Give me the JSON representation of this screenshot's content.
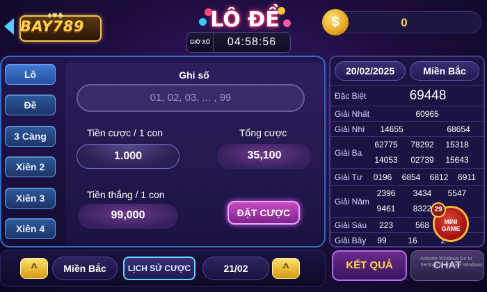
{
  "header": {
    "logo": "BAY789",
    "title": "LÔ ĐỀ",
    "timer_label": "GIỜ XỔ",
    "timer_value": "04:58:56",
    "balance": "0"
  },
  "tabs": [
    "Lô",
    "Đề",
    "3 Càng",
    "Xiên 2",
    "Xiên 3",
    "Xiên 4"
  ],
  "form": {
    "numbers_label": "Ghi số",
    "numbers_placeholder": "01, 02, 03, ... , 99",
    "bet_per_label": "Tiền cược / 1 con",
    "bet_per_value": "1.000",
    "total_label": "Tổng cược",
    "total_value": "35,100",
    "win_per_label": "Tiền thắng / 1 con",
    "win_per_value": "99,000",
    "place_bet_label": "ĐẶT CƯỢC"
  },
  "bottom": {
    "region": "Miền Bắc",
    "history_label": "LỊCH SỬ CƯỢC",
    "date": "21/02",
    "up_symbol": "^"
  },
  "results": {
    "date": "20/02/2025",
    "region": "Miền Bắc",
    "rows": [
      {
        "label": "Đặc Biệt",
        "values": [
          "69448"
        ]
      },
      {
        "label": "Giải Nhất",
        "values": [
          "60965"
        ]
      },
      {
        "label": "Giải Nhì",
        "values": [
          "14655",
          "68654"
        ]
      },
      {
        "label": "Giải Ba",
        "values": [
          "62775",
          "78292",
          "15318",
          "14053",
          "02739",
          "15643"
        ]
      },
      {
        "label": "Giải Tư",
        "values": [
          "0196",
          "6854",
          "6812",
          "6911"
        ]
      },
      {
        "label": "Giải Năm",
        "values": [
          "2396",
          "3434",
          "5547",
          "9461",
          "8322",
          ""
        ]
      },
      {
        "label": "Giải Sáu",
        "values": [
          "223",
          "568",
          ""
        ]
      },
      {
        "label": "Giải Bảy",
        "values": [
          "99",
          "16",
          "2",
          ""
        ]
      }
    ]
  },
  "mini_game": {
    "count": "29",
    "label_1": "MINI",
    "label_2": "GAME"
  },
  "actions": {
    "result_label": "KẾT QUẢ",
    "chat_label": "CHAT"
  },
  "watermark": "Activate Windows Go to Settings to activate Windows.",
  "colors": {
    "accent_gold": "#ffd84a",
    "panel_border": "#2f6fc6",
    "bet_button": "#c84cc0"
  }
}
